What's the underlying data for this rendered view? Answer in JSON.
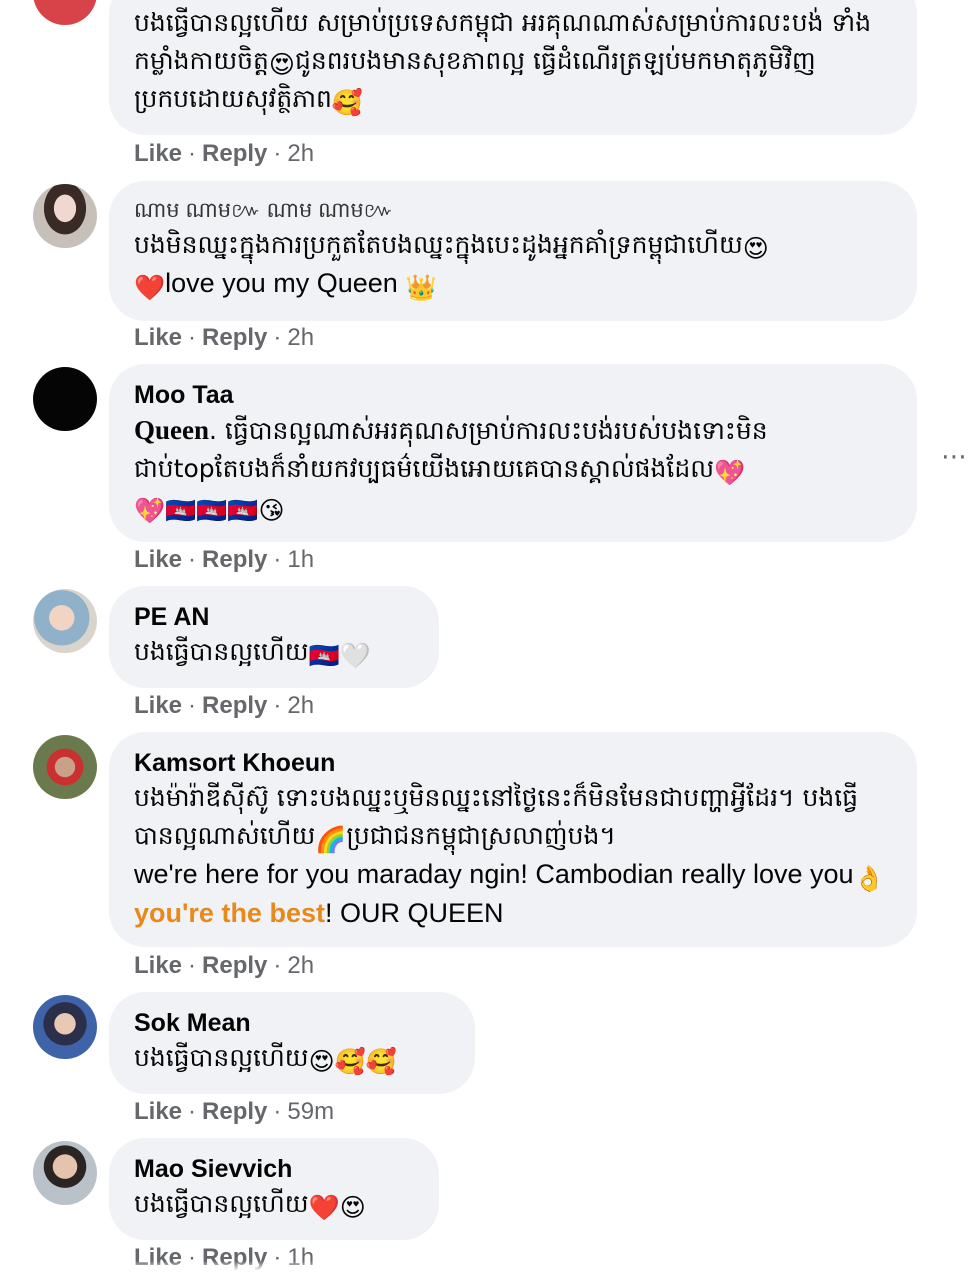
{
  "ui": {
    "like": "Like",
    "reply": "Reply",
    "dot": "·"
  },
  "colors": {
    "bubble": "#f0f2f5",
    "meta": "#65676b",
    "link": "#e8891b",
    "text": "#050505"
  },
  "comments": [
    {
      "author": "",
      "text_km": "បងធ្វើបានល្អហើយ សម្រាប់ប្រទេសកម្ពុជា អរគុណណាស់សម្រាប់ការលះបង់ ទាំងកម្លាំងកាយចិត្ត",
      "text_km_2": "ជូនពរបងមានសុខភាពល្អ ធ្វើដំណើរត្រឡប់មកមាតុភូមិវិញប្រកបដោយសុវត្ថិភាព",
      "emoji_1": "😍",
      "emoji_2": "🥰",
      "time": "2h"
    },
    {
      "author": "ណាម ណាម៚ ណាម ណាម៚",
      "text_km": "បងមិនឈ្នះក្នុងការប្រកួតតែបងឈ្នះក្នុងបេះដូងអ្នកគាំទ្រកម្ពុជាហើយ",
      "emoji_1": "😍",
      "emoji_2": "❤️",
      "text_en": "love you my Queen",
      "emoji_3": "👑",
      "time": "2h"
    },
    {
      "author": "Moo Taa",
      "text_bold": "Queen",
      "text_km": ". ធ្វើបានល្អណាស់អរគុណសម្រាប់ការលះបង់របស់បងទោះមិនជាប់top",
      "text_km_2": "តែបងក៏នាំយកវប្បធម៌យើងអោយគេបានស្គាល់ផងដែល",
      "emoji_1": "💖",
      "emoji_2": "💖",
      "emoji_3": "🇰🇭🇰🇭🇰🇭",
      "emoji_4": "😘",
      "time": "1h"
    },
    {
      "author": "PE AN",
      "text_km": "បងធ្វើបានល្អហើយ",
      "emoji_1": "🇰🇭",
      "emoji_2": "🤍",
      "time": "2h"
    },
    {
      "author": "Kamsort Khoeun",
      "text_km": "បងម៉ារ៉ាឌីស៊ីស៊ូ ទោះបងឈ្នះឬមិនឈ្នះនៅថ្ងៃនេះក៏មិនមែនជាបញ្ហាអ្វីដែរ។ បងធ្វើបានល្អណាស់ហើយ",
      "emoji_1": "🌈",
      "text_km_2": "ប្រជាជនកម្ពុជាស្រលាញ់បង។",
      "text_en": "we're here for you maraday ngin! Cambodian really love you",
      "emoji_2": "👌",
      "text_link": "you're the best",
      "text_en_2": "! OUR QUEEN",
      "time": "2h"
    },
    {
      "author": "Sok Mean",
      "text_km": "បងធ្វើបានល្អហើយ",
      "emoji_1": "😍🥰🥰",
      "time": "59m"
    },
    {
      "author": "Mao Sievvich",
      "text_km": "បងធ្វើបានល្អហើយ",
      "emoji_1": "❤️😍",
      "time": "1h"
    }
  ],
  "more_icon": "⋯"
}
